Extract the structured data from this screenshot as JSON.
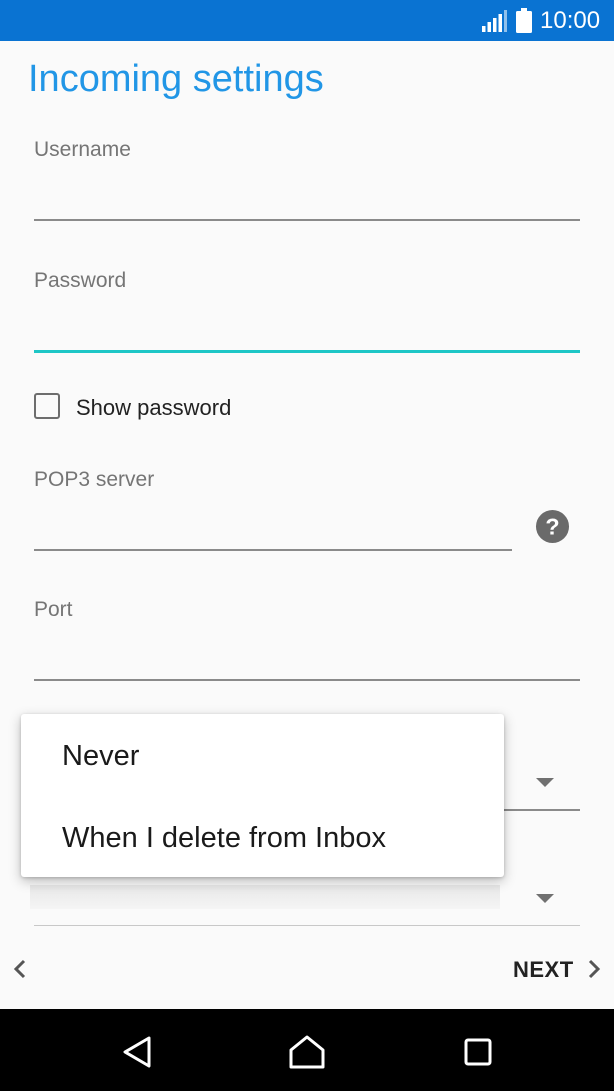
{
  "status_bar": {
    "time": "10:00",
    "signal_icon": "signal-icon",
    "battery_icon": "battery-icon"
  },
  "page": {
    "title": "Incoming settings"
  },
  "form": {
    "username": {
      "label": "Username",
      "value": ""
    },
    "password": {
      "label": "Password",
      "value": ""
    },
    "show_password": {
      "label": "Show password",
      "checked": false
    },
    "pop3_server": {
      "label": "POP3 server",
      "value": "",
      "help_icon": "help-icon"
    },
    "port": {
      "label": "Port",
      "value": ""
    }
  },
  "dropdown_menu": {
    "options": [
      "Never",
      "When I delete from Inbox"
    ]
  },
  "footer": {
    "next_label": "NEXT",
    "back_icon": "chevron-left-icon",
    "next_icon": "chevron-right-icon"
  },
  "nav_bar": {
    "icons": [
      "back-triangle-icon",
      "home-icon",
      "recents-icon"
    ]
  },
  "colors": {
    "status_bar": "#0a73d2",
    "accent": "#2196e6",
    "active_underline": "#1ec6c6"
  }
}
